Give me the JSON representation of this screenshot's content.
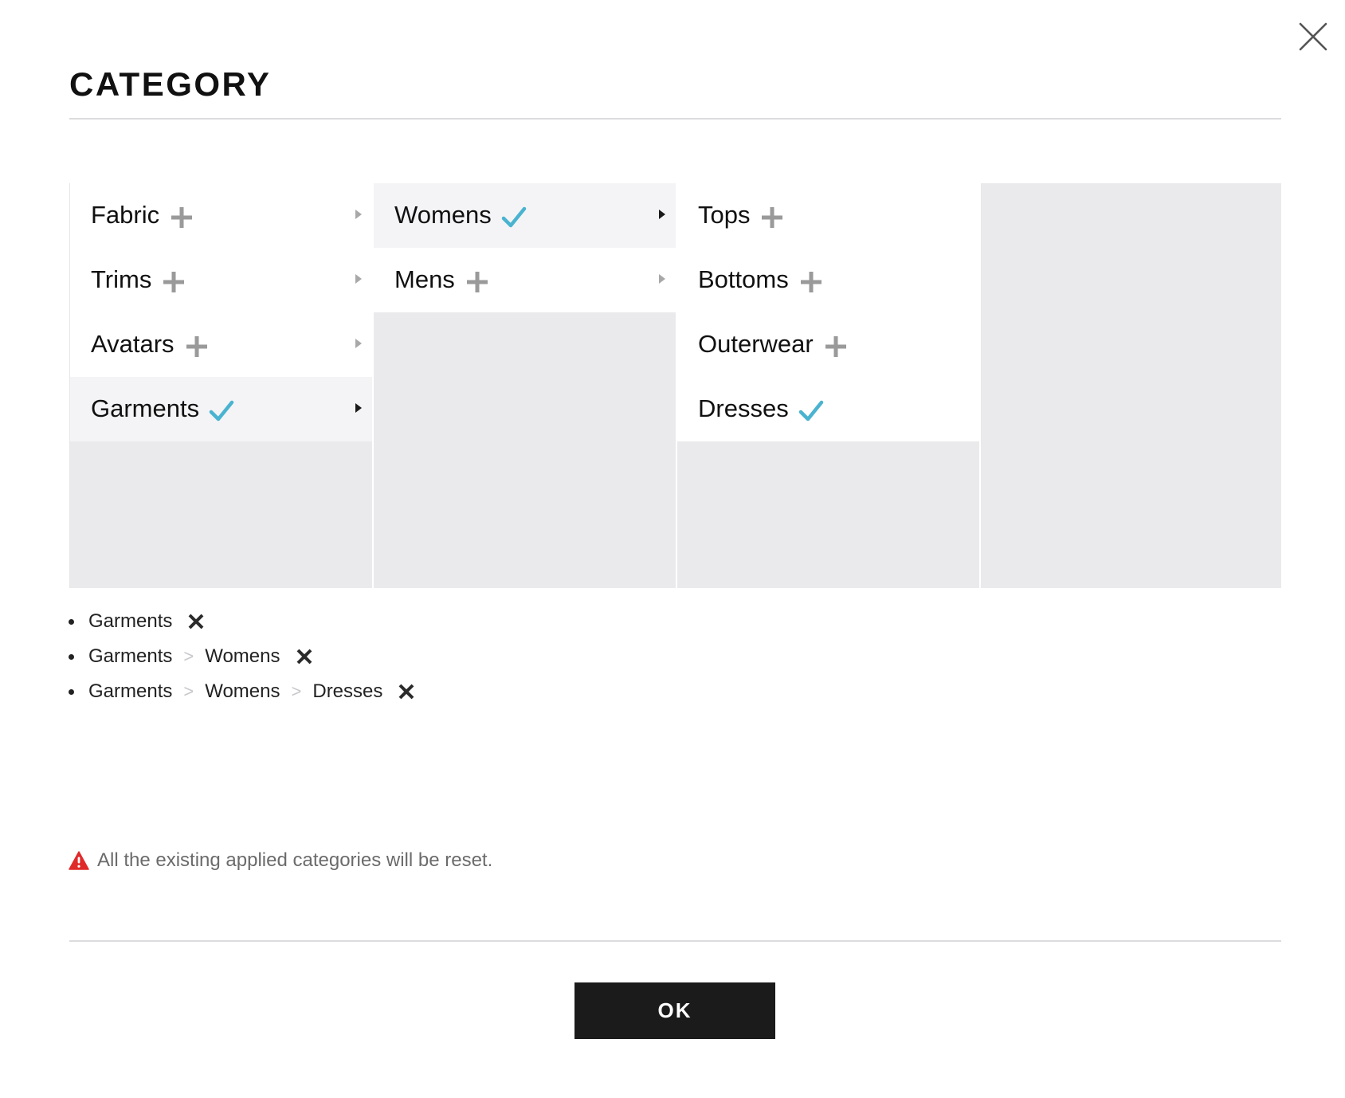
{
  "modal": {
    "title": "CATEGORY",
    "ok_label": "OK",
    "warning_text": "All the existing applied categories will be reset."
  },
  "columns": [
    {
      "items": [
        {
          "label": "Fabric",
          "status": "add",
          "has_children": true,
          "selected": false
        },
        {
          "label": "Trims",
          "status": "add",
          "has_children": true,
          "selected": false
        },
        {
          "label": "Avatars",
          "status": "add",
          "has_children": true,
          "selected": false
        },
        {
          "label": "Garments",
          "status": "checked",
          "has_children": true,
          "selected": true
        }
      ]
    },
    {
      "items": [
        {
          "label": "Womens",
          "status": "checked",
          "has_children": true,
          "selected": true
        },
        {
          "label": "Mens",
          "status": "add",
          "has_children": true,
          "selected": false
        }
      ]
    },
    {
      "items": [
        {
          "label": "Tops",
          "status": "add",
          "has_children": false,
          "selected": false
        },
        {
          "label": "Bottoms",
          "status": "add",
          "has_children": false,
          "selected": false
        },
        {
          "label": "Outerwear",
          "status": "add",
          "has_children": false,
          "selected": false
        },
        {
          "label": "Dresses",
          "status": "checked",
          "has_children": false,
          "selected": false
        }
      ]
    },
    {
      "items": []
    }
  ],
  "applied": [
    {
      "path": [
        "Garments"
      ]
    },
    {
      "path": [
        "Garments",
        "Womens"
      ]
    },
    {
      "path": [
        "Garments",
        "Womens",
        "Dresses"
      ]
    }
  ],
  "path_separator": ">",
  "icons": {
    "close": "close-icon",
    "add": "plus-icon",
    "checked": "check-icon",
    "expand": "caret-right-icon",
    "remove": "remove-x-icon",
    "warning": "warning-triangle-icon"
  },
  "colors": {
    "check": "#4ab3d0",
    "plus": "#9a9a9a",
    "warning": "#e02a2a",
    "button_bg": "#1b1b1b",
    "panel_bg": "#eaeaec"
  }
}
